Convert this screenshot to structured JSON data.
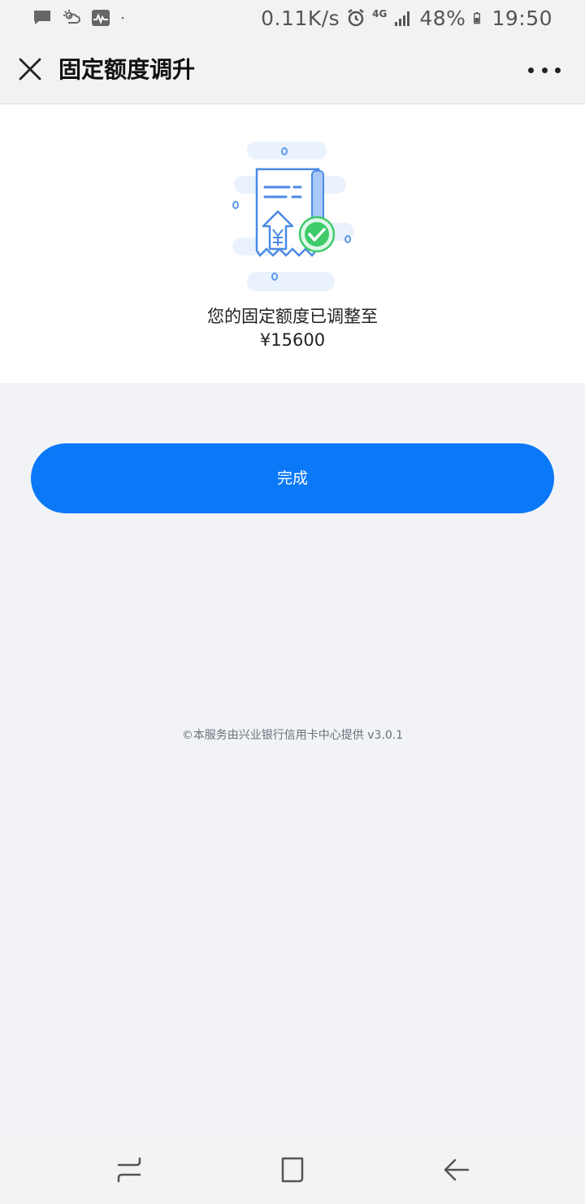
{
  "status_bar": {
    "network_speed": "0.11K/s",
    "network_type": "4G",
    "battery": "48%",
    "time": "19:50",
    "left_icons": [
      "message-icon",
      "weather-icon",
      "activity-icon",
      "dot-icon"
    ],
    "right_icons": [
      "alarm-icon",
      "signal-icon",
      "battery-icon"
    ]
  },
  "nav": {
    "title": "固定额度调升",
    "close_icon": "close-icon",
    "more_icon": "more-icon"
  },
  "result": {
    "message": "您的固定额度已调整至",
    "amount": "¥15600",
    "illustration_icon": "receipt-check-icon"
  },
  "actions": {
    "done_label": "完成"
  },
  "footer": {
    "note": "©本服务由兴业银行信用卡中心提供 v3.0.1"
  },
  "android_nav": {
    "icons": [
      "recent-apps-icon",
      "home-icon",
      "back-icon"
    ]
  },
  "colors": {
    "primary": "#0a78f7",
    "background": "#f1f3f7",
    "card": "#ffffff",
    "check_green": "#3fcb6a"
  }
}
